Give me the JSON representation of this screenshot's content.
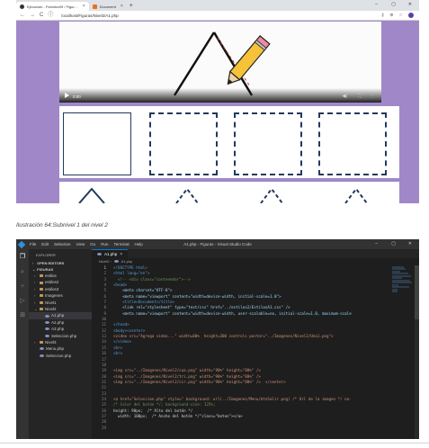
{
  "browser": {
    "tabs": [
      {
        "label": "Ejecución - Fesmicc09 / Figur…",
        "icon": "github-icon",
        "active": true
      },
      {
        "label": "Document",
        "icon": "document-icon",
        "active": false
      }
    ],
    "new_tab_label": "+",
    "window_controls": [
      "–",
      "▢",
      "✕"
    ],
    "nav": {
      "back": "←",
      "forward": "→",
      "reload": "C"
    },
    "url": "localhost/Figuras/Nivel2/A1.php",
    "address_icons": [
      "key-icon",
      "zoom-icon",
      "star-icon",
      "profile-avatar"
    ],
    "video": {
      "time": "0:00",
      "right_icons": [
        "volume-icon",
        "fullscreen-icon",
        "more-icon"
      ]
    },
    "colors": {
      "page_background": "#a088c8",
      "shape_stroke": "#223a5e"
    }
  },
  "caption": "Ilustración 64:Subnivel 1 del nivel 2",
  "vscode": {
    "menu": [
      "File",
      "Edit",
      "Selection",
      "View",
      "Go",
      "Run",
      "Terminal",
      "Help"
    ],
    "title": "A1.php - Figuras - Visual Studio Code",
    "window_controls": [
      "–",
      "▢",
      "✕"
    ],
    "activity_icons": [
      "files-icon",
      "search-icon",
      "source-control-icon",
      "run-icon",
      "extensions-icon"
    ],
    "sidebar": {
      "header": "EXPLORER",
      "open_editors": "OPEN EDITORS",
      "workspace": "FIGURAS",
      "tree": [
        {
          "label": "estilos",
          "kind": "folder",
          "depth": 1
        },
        {
          "label": "estilos2",
          "kind": "folder",
          "depth": 1
        },
        {
          "label": "estilos3",
          "kind": "folder",
          "depth": 1
        },
        {
          "label": "Imagenes",
          "kind": "folder",
          "depth": 1
        },
        {
          "label": "Nivel1",
          "kind": "folder",
          "depth": 1
        },
        {
          "label": "Nivel2",
          "kind": "folder",
          "depth": 1
        },
        {
          "label": "A1.php",
          "kind": "php",
          "depth": 2,
          "selected": true
        },
        {
          "label": "A2.php",
          "kind": "php",
          "depth": 2
        },
        {
          "label": "A3.php",
          "kind": "php",
          "depth": 2
        },
        {
          "label": "Seleccion.php",
          "kind": "php",
          "depth": 2
        },
        {
          "label": "Nivel3",
          "kind": "folder",
          "depth": 1
        },
        {
          "label": "Menu.php",
          "kind": "php",
          "depth": 1
        },
        {
          "label": "Seleccion.php",
          "kind": "php",
          "depth": 1
        }
      ]
    },
    "editor": {
      "tab": "A1.php",
      "breadcrumb": [
        "Nivel2",
        "A1.php"
      ],
      "lines": [
        {
          "n": "1",
          "text": "<!DOCTYPE html>",
          "cls": "c-tag"
        },
        {
          "n": "2",
          "text": "<html lang=\"en\">",
          "cls": "c-tag"
        },
        {
          "n": "3",
          "text": "  <!-- <div class=\"contenedor\">-->",
          "cls": "c-cmt"
        },
        {
          "n": "4",
          "text": "<head>",
          "cls": "c-tag"
        },
        {
          "n": "5",
          "text": "    <meta charset=\"UTF-8\">",
          "cls": "c-attr"
        },
        {
          "n": "6",
          "text": "    <meta name=\"viewport\" content=\"width=device-width, initial-scale=1.0\">",
          "cls": "c-attr"
        },
        {
          "n": "7",
          "text": "    <title>Document</title>",
          "cls": "c-tag"
        },
        {
          "n": "8",
          "text": "    <link rel=\"stylesheet\" type=\"text/css\" href=\"../estilos2/EstilosA1.css\" />",
          "cls": "c-attr"
        },
        {
          "n": "9",
          "text": "    <meta name=\"viewport\" content=\"width=device-width, user-scalable=no, initial-scale=1.0, maximum-scale",
          "cls": "c-attr"
        },
        {
          "n": "10",
          "text": "",
          "cls": "c-txt"
        },
        {
          "n": "11",
          "text": "</head>",
          "cls": "c-tag"
        },
        {
          "n": "12",
          "text": "<body><center>",
          "cls": "c-tag"
        },
        {
          "n": "13",
          "text": "<video src=\"Agrega video...\" width=80%  height=300 controls poster=\"../Imagenes/Nivel2/Uno1.png\">",
          "cls": "c-str"
        },
        {
          "n": "14",
          "text": "</video>",
          "cls": "c-tag"
        },
        {
          "n": "15",
          "text": "<br>",
          "cls": "c-tag"
        },
        {
          "n": "16",
          "text": "<br>",
          "cls": "c-tag"
        },
        {
          "n": "17",
          "text": "",
          "cls": "c-txt"
        },
        {
          "n": "18",
          "text": "",
          "cls": "c-txt"
        },
        {
          "n": "19",
          "text": "<img src=\"../Imagenes/Nivel2/cua.png\" width=\"90%\" height=\"80%\" />",
          "cls": "c-str"
        },
        {
          "n": "20",
          "text": "<img src=\"../Imagenes/Nivel2/tri.png\" width=\"90%\" height=\"80%\" />",
          "cls": "c-str"
        },
        {
          "n": "21",
          "text": "<img src=\"../Imagenes/Nivel2/cir.png\" width=\"90%\" height=\"80%\" />  </center>",
          "cls": "c-str"
        },
        {
          "n": "22",
          "text": "",
          "cls": "c-txt"
        },
        {
          "n": "23",
          "text": "",
          "cls": "c-txt"
        },
        {
          "n": "24",
          "text": "<a href=\"Seleccion.php\" style=\" background: url(../Imagenes/Menu/btnSalir.png) /* Url de la imagen */ no-",
          "cls": "c-str"
        },
        {
          "n": "25",
          "text": "/* Color del botón */; background-size: 125%;",
          "cls": "c-cmt"
        },
        {
          "n": "26",
          "text": "height: 90px;  /* Alto del botón */",
          "cls": "c-mix"
        },
        {
          "n": "27",
          "text": "  width: 100px;  /* Ancho del botón */\"class=\"boton\"></a>",
          "cls": "c-mix"
        },
        {
          "n": "28",
          "text": "",
          "cls": "c-txt"
        },
        {
          "n": "29",
          "text": "",
          "cls": "c-txt"
        }
      ]
    },
    "colors": {
      "background": "#1e1e1e",
      "sidebar": "#252526",
      "activity_bar": "#333333",
      "accent": "#0078d4"
    }
  }
}
